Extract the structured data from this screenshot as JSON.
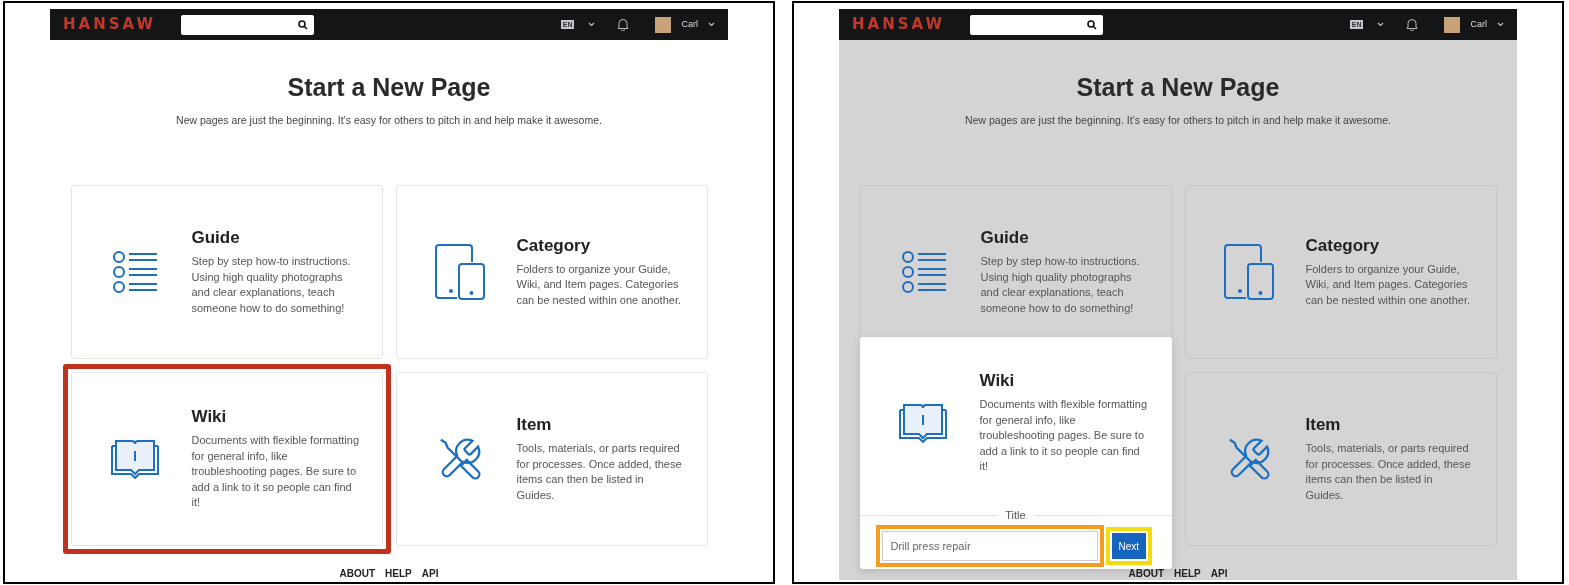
{
  "panels": [
    {
      "dimmed": false,
      "header": {
        "logo": "HANSAW",
        "language": "EN",
        "user": "Carl"
      },
      "heading": "Start a New Page",
      "subheading": "New pages are just the beginning. It’s easy for others to pitch in and help make it awesome.",
      "cards": [
        {
          "kind": "guide",
          "title": "Guide",
          "description": "Step by step how-to instructions. Using high quality photographs and clear explanations, teach someone how to do something!"
        },
        {
          "kind": "category",
          "title": "Category",
          "description": "Folders to organize your Guide, Wiki, and Item pages. Categories can be nested within one another."
        },
        {
          "kind": "wiki",
          "title": "Wiki",
          "description": "Documents with flexible formatting for general info, like troubleshooting pages. Be sure to add a link to it so people can find it!",
          "color": "#c0321c"
        },
        {
          "kind": "item",
          "title": "Item",
          "description": "Tools, materials, or parts required for processes. Once added, these items can then be listed in Guides."
        }
      ],
      "footer_links": [
        "ABOUT",
        "HELP",
        "API"
      ]
    },
    {
      "dimmed": true,
      "header": {
        "logo": "HANSAW",
        "language": "EN",
        "user": "Carl"
      },
      "heading": "Start a New Page",
      "subheading": "New pages are just the beginning. It’s easy for others to pitch in and help make it awesome.",
      "cards": [
        {
          "kind": "guide",
          "title": "Guide",
          "description": "Step by step how-to instructions. Using high quality photographs and clear explanations, teach someone how to do something!"
        },
        {
          "kind": "category",
          "title": "Category",
          "description": "Folders to organize your Guide, Wiki, and Item pages. Categories can be nested within one another."
        },
        {
          "kind": "wiki",
          "title": "Wiki",
          "description": "Documents with flexible formatting for general info, like troubleshooting pages. Be sure to add a link to it so people can find it!",
          "form": {
            "label": "Title",
            "field": {
              "value": "Drill press repair",
              "color": "#f39c1f"
            },
            "button": {
              "label": "Next",
              "color": "#f2dc10"
            }
          }
        },
        {
          "kind": "item",
          "title": "Item",
          "description": "Tools, materials, or parts required for processes. Once added, these items can then be listed in Guides."
        }
      ],
      "footer_links": [
        "ABOUT",
        "HELP",
        "API"
      ]
    }
  ]
}
